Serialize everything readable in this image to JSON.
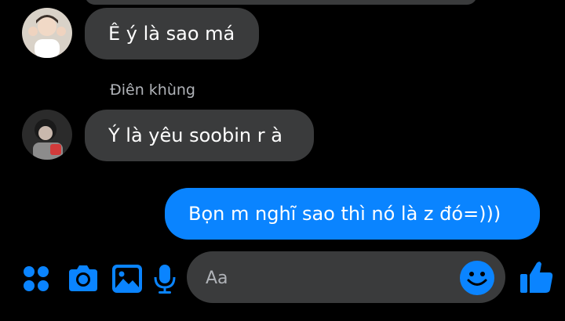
{
  "messages": [
    {
      "text": "Ê ý là sao má"
    },
    {
      "sender": "Điên khùng",
      "text": "Ý là yêu soobin r à"
    },
    {
      "text": "Bọn m nghĩ sao thì nó là z đó=)))"
    }
  ],
  "composer": {
    "placeholder": "Aa",
    "icons": [
      "grid-apps-icon",
      "camera-icon",
      "gallery-icon",
      "microphone-icon",
      "emoji-icon",
      "thumbs-up-icon"
    ]
  },
  "colors": {
    "background": "#000000",
    "incoming_bubble": "#3a3b3c",
    "outgoing_bubble": "#0a84ff",
    "accent": "#0a84ff"
  }
}
